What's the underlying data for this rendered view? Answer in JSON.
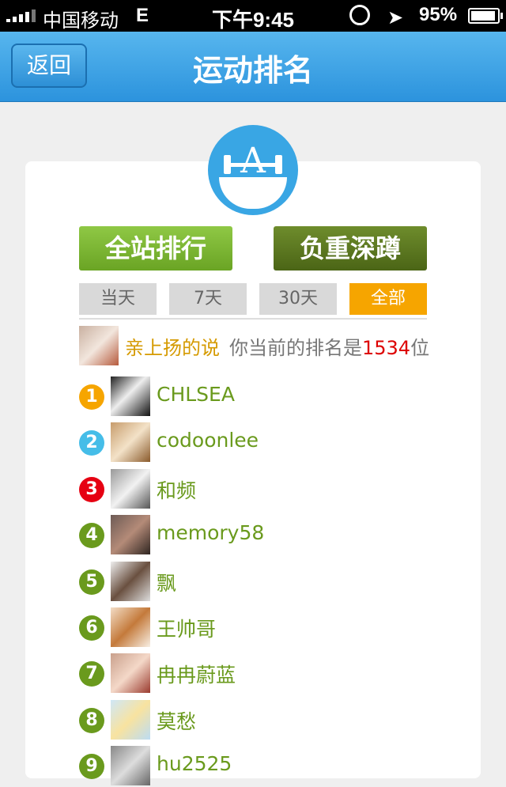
{
  "status": {
    "carrier": "中国移动",
    "network": "E",
    "time": "下午9:45",
    "battery": "95%",
    "battery_level": 0.95
  },
  "nav": {
    "back": "返回",
    "title": "运动排名"
  },
  "buttons": {
    "site_rank": "全站排行",
    "squat": "负重深蹲"
  },
  "tabs": [
    {
      "label": "当天"
    },
    {
      "label": "7天"
    },
    {
      "label": "30天"
    },
    {
      "label": "全部"
    }
  ],
  "active_tab": 3,
  "me": {
    "name": "亲上扬的说",
    "rank_prefix": "你当前的排名是",
    "rank": "1534",
    "rank_suffix": "位"
  },
  "colors": {
    "accent_blue": "#39a6e4",
    "green": "#6a9a1d",
    "orange": "#f6a500",
    "rank1": "#f6a500",
    "rank2": "#45bde8",
    "rank3": "#e60012",
    "rank_other": "#6a9a1d"
  },
  "rank_list": [
    {
      "rank": "1",
      "name": "CHLSEA"
    },
    {
      "rank": "2",
      "name": "codoonlee"
    },
    {
      "rank": "3",
      "name": "和频"
    },
    {
      "rank": "4",
      "name": "memory58"
    },
    {
      "rank": "5",
      "name": "飘"
    },
    {
      "rank": "6",
      "name": "王帅哥"
    },
    {
      "rank": "7",
      "name": "冉冉蔚蓝"
    },
    {
      "rank": "8",
      "name": "莫愁"
    },
    {
      "rank": "9",
      "name": "hu2525"
    }
  ]
}
